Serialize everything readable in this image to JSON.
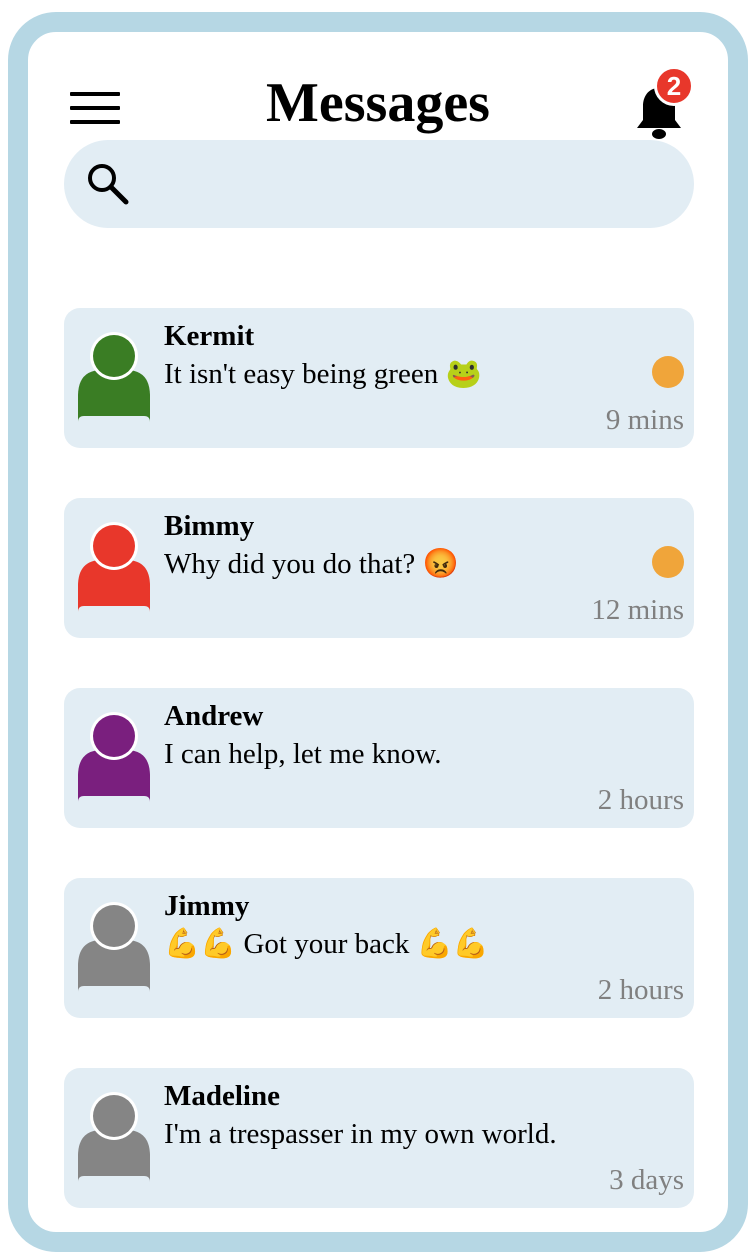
{
  "header": {
    "title": "Messages",
    "notification_count": "2"
  },
  "search": {
    "placeholder": ""
  },
  "colors": {
    "frame_border": "#b6d7e4",
    "card_bg": "#e2edf4",
    "badge": "#e8372b",
    "unread_dot": "#f0a53a",
    "time_text": "#808080"
  },
  "conversations": [
    {
      "name": "Kermit",
      "message": "It isn't easy being green 🐸",
      "time": "9 mins",
      "unread": true,
      "avatar_color": "#3a7d24"
    },
    {
      "name": "Bimmy",
      "message": "Why did you do that? 😡",
      "time": "12 mins",
      "unread": true,
      "avatar_color": "#e8372b"
    },
    {
      "name": "Andrew",
      "message": "I can help, let me know.",
      "time": "2 hours",
      "unread": false,
      "avatar_color": "#7a1f7e"
    },
    {
      "name": "Jimmy",
      "message": "💪💪 Got your back 💪💪",
      "time": "2 hours",
      "unread": false,
      "avatar_color": "#858585"
    },
    {
      "name": "Madeline",
      "message": "I'm a trespasser in my own world.",
      "time": "3 days",
      "unread": false,
      "avatar_color": "#858585"
    }
  ]
}
